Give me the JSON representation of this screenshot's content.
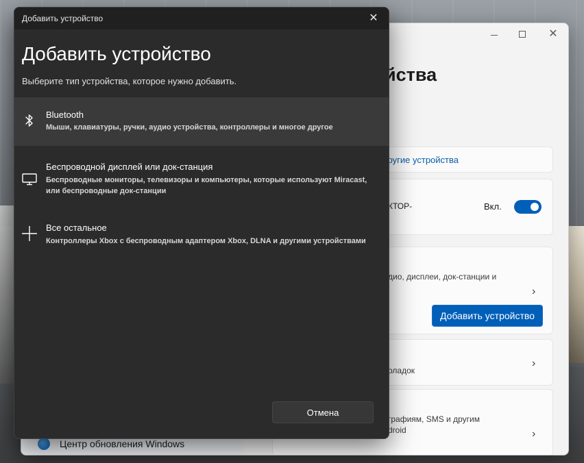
{
  "dialog": {
    "title_bar": "Добавить устройство",
    "heading": "Добавить устройство",
    "subtitle": "Выберите тип устройства, которое нужно добавить.",
    "options": [
      {
        "icon": "bluetooth-icon",
        "title": "Bluetooth",
        "description": "Мыши, клавиатуры, ручки, аудио устройства, контроллеры и многое другое",
        "selected": true
      },
      {
        "icon": "monitor-icon",
        "title": "Беспроводной дисплей или док-станция",
        "description": "Беспроводные мониторы, телевизоры и компьютеры, которые используют Miracast, или беспроводные док-станции",
        "selected": false
      },
      {
        "icon": "plus-icon",
        "title": "Все остальное",
        "description": "Контроллеры Xbox с беспроводным адаптером Xbox, DLNA и другими устройствами",
        "selected": false
      }
    ],
    "cancel_label": "Отмена",
    "close_glyph": "✕"
  },
  "settings": {
    "page_title_partial": "йства",
    "link_partial": "другие устройства",
    "bt_card_partial": "КТОР-",
    "toggle_label": "Вкл.",
    "toggle_on": true,
    "add_card_desc_partial": "дио, дисплеи, док-станции и",
    "add_button_label": "Добавить устройство",
    "mouse_card_desc_partial": "оладок",
    "phone_card_desc1_partial": "графиям, SMS и другим",
    "phone_card_desc2_partial": "droid",
    "sidebar_item_label": "Центр обновления Windows",
    "chevron_glyph": "›",
    "window_close_glyph": "✕"
  },
  "colors": {
    "dialog_bg": "#2b2b2b",
    "dialog_titlebar": "#202020",
    "selected_row": "#3a3a3a",
    "accent": "#005fb8"
  }
}
